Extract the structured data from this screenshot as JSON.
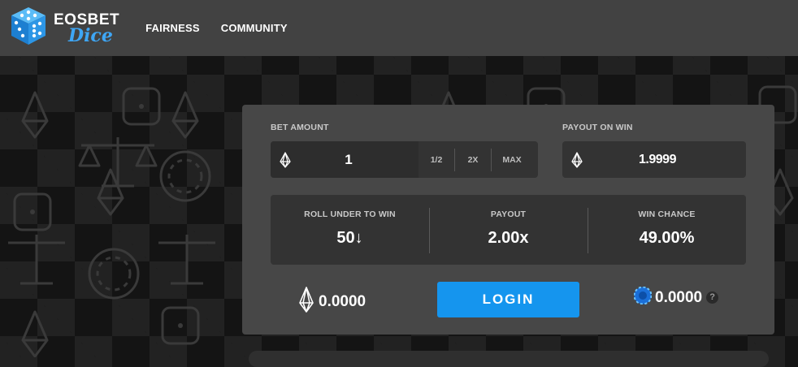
{
  "brand": {
    "line1": "EOSBET",
    "line2": "Dice",
    "icon": "dice-logo-icon"
  },
  "nav": {
    "fairness": "FAIRNESS",
    "community": "COMMUNITY"
  },
  "bet": {
    "label": "BET AMOUNT",
    "value": "1",
    "half_label": "1/2",
    "double_label": "2X",
    "max_label": "MAX",
    "currency_icon": "eos-icon"
  },
  "payout_on_win": {
    "label": "PAYOUT ON WIN",
    "value": "1.9999",
    "currency_icon": "eos-icon"
  },
  "stats": {
    "roll_under": {
      "label": "ROLL UNDER TO WIN",
      "value": "50↓"
    },
    "payout": {
      "label": "PAYOUT",
      "value": "2.00x"
    },
    "win_chance": {
      "label": "WIN CHANCE",
      "value": "49.00%"
    }
  },
  "balances": {
    "eos": {
      "value": "0.0000",
      "icon": "eos-icon"
    },
    "bet_token": {
      "value": "0.0000",
      "icon": "bet-token-icon",
      "help_icon": "question-icon",
      "help_glyph": "?"
    }
  },
  "login_button": "LOGIN",
  "colors": {
    "accent": "#1595ee",
    "header": "#424242",
    "panel": "#474747",
    "logo_blue": "#3ea6f5"
  }
}
